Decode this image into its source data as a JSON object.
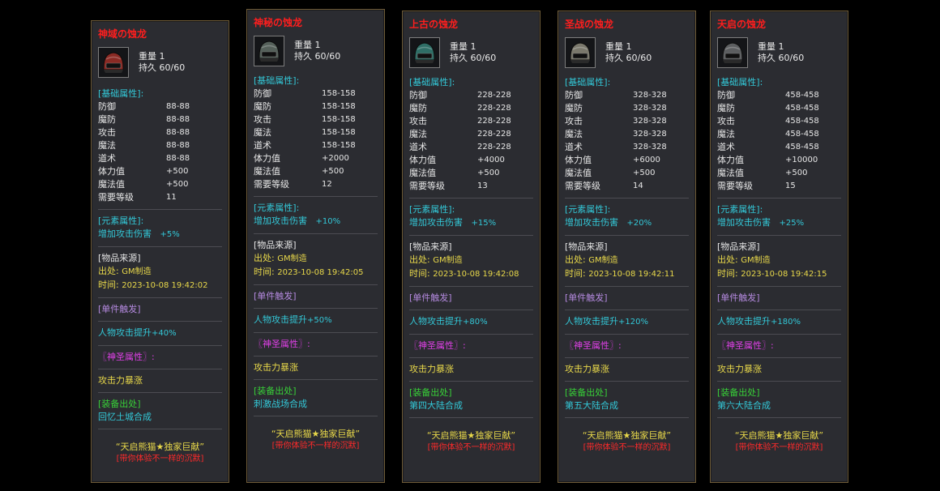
{
  "labels": {
    "weight": "重量",
    "durability": "持久",
    "base_attr": "[基础属性]:",
    "element_attr": "[元素属性]:",
    "source_attr": "[物品来源]",
    "origin_label": "出处:",
    "time_label": "时间:",
    "single_trigger": "[单件触发]",
    "holy_attr": "〖神圣属性〗:",
    "holy_effect": "攻击力暴涨",
    "equip_source": "[装备出处]",
    "element_effect": "增加攻击伤害",
    "attack_boost": "人物攻击提升",
    "stat_names": [
      "防御",
      "魔防",
      "攻击",
      "魔法",
      "道术",
      "体力值",
      "魔法值",
      "需要等级"
    ],
    "footer_line1": "“天启熊猫★独家巨献”",
    "footer_line2": "[带你体验不一样的沉默]"
  },
  "cards": [
    {
      "name": "神域の蚀龙",
      "weight": "1",
      "durability": "60/60",
      "stats": [
        "88-88",
        "88-88",
        "88-88",
        "88-88",
        "88-88",
        "+500",
        "+500",
        "11"
      ],
      "element_value": "+5%",
      "origin": "GM制造",
      "time": "2023-10-08 19:42:02",
      "attack_boost": "+40%",
      "equip_origin": "回忆土城合成",
      "helmet_color": "#8a2a24"
    },
    {
      "name": "神秘の蚀龙",
      "weight": "1",
      "durability": "60/60",
      "stats": [
        "158-158",
        "158-158",
        "158-158",
        "158-158",
        "158-158",
        "+2000",
        "+500",
        "12"
      ],
      "element_value": "+10%",
      "origin": "GM制造",
      "time": "2023-10-08 19:42:05",
      "attack_boost": "+50%",
      "equip_origin": "刺激战场合成",
      "helmet_color": "#55605a"
    },
    {
      "name": "上古の蚀龙",
      "weight": "1",
      "durability": "60/60",
      "stats": [
        "228-228",
        "228-228",
        "228-228",
        "228-228",
        "228-228",
        "+4000",
        "+500",
        "13"
      ],
      "element_value": "+15%",
      "origin": "GM制造",
      "time": "2023-10-08 19:42:08",
      "attack_boost": "+80%",
      "equip_origin": "第四大陆合成",
      "helmet_color": "#2f6e66"
    },
    {
      "name": "圣战の蚀龙",
      "weight": "1",
      "durability": "60/60",
      "stats": [
        "328-328",
        "328-328",
        "328-328",
        "328-328",
        "328-328",
        "+6000",
        "+500",
        "14"
      ],
      "element_value": "+20%",
      "origin": "GM制造",
      "time": "2023-10-08 19:42:11",
      "attack_boost": "+120%",
      "equip_origin": "第五大陆合成",
      "helmet_color": "#7a786c"
    },
    {
      "name": "天启の蚀龙",
      "weight": "1",
      "durability": "60/60",
      "stats": [
        "458-458",
        "458-458",
        "458-458",
        "458-458",
        "458-458",
        "+10000",
        "+500",
        "15"
      ],
      "element_value": "+25%",
      "origin": "GM制造",
      "time": "2023-10-08 19:42:15",
      "attack_boost": "+180%",
      "equip_origin": "第六大陆合成",
      "helmet_color": "#5c5e60"
    }
  ]
}
